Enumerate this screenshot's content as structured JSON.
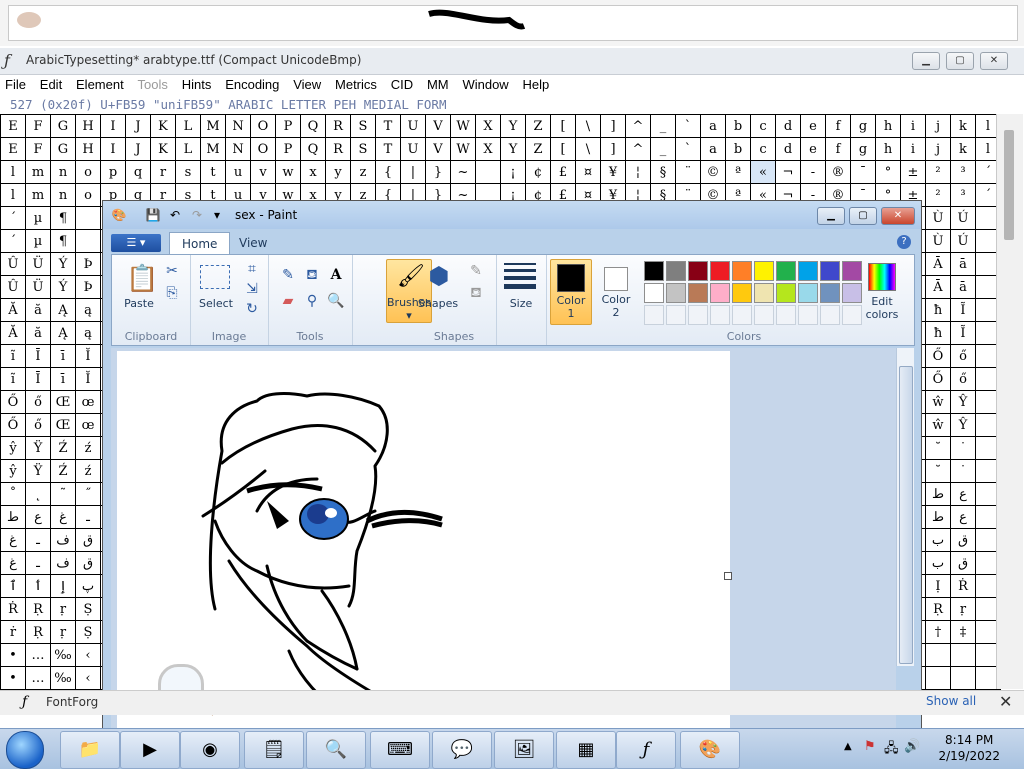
{
  "fontforge": {
    "title": "ArabicTypesetting*  arabtype.ttf (Compact UnicodeBmp)",
    "menu": [
      "File",
      "Edit",
      "Element",
      "Tools",
      "Hints",
      "Encoding",
      "View",
      "Metrics",
      "CID",
      "MM",
      "Window",
      "Help"
    ],
    "info_line": "527 (0x20f) U+FB59 \"uniFB59\" ARABIC LETTER PEH MEDIAL FORM",
    "grid_rows": [
      [
        "E",
        "F",
        "G",
        "H",
        "I",
        "J",
        "K",
        "L",
        "M",
        "N",
        "O",
        "P",
        "Q",
        "R",
        "S",
        "T",
        "U",
        "V",
        "W",
        "X",
        "Y",
        "Z",
        "[",
        "\\",
        "]",
        "^",
        "_",
        "`",
        "a",
        "b",
        "c",
        "d",
        "e",
        "f",
        "g",
        "h",
        "i",
        "j",
        "k",
        "l"
      ],
      [
        "E",
        "F",
        "G",
        "H",
        "I",
        "J",
        "K",
        "L",
        "M",
        "N",
        "O",
        "P",
        "Q",
        "R",
        "S",
        "T",
        "U",
        "V",
        "W",
        "X",
        "Y",
        "Z",
        "[",
        "\\",
        "]",
        "^",
        "_",
        "`",
        "a",
        "b",
        "c",
        "d",
        "e",
        "f",
        "g",
        "h",
        "i",
        "j",
        "k",
        "l"
      ],
      [
        "l",
        "m",
        "n",
        "o",
        "p",
        "q",
        "r",
        "s",
        "t",
        "u",
        "v",
        "w",
        "x",
        "y",
        "z",
        "{",
        "|",
        "}",
        "~",
        "",
        "¡",
        "¢",
        "£",
        "¤",
        "¥",
        "¦",
        "§",
        "¨",
        "©",
        "ª",
        "«",
        "¬",
        "-",
        "®",
        "¯",
        "°",
        "±",
        "²",
        "³",
        "´"
      ],
      [
        "l",
        "m",
        "n",
        "o",
        "p",
        "q",
        "r",
        "s",
        "t",
        "u",
        "v",
        "w",
        "x",
        "y",
        "z",
        "{",
        "|",
        "}",
        "~",
        "",
        "¡",
        "¢",
        "£",
        "¤",
        "¥",
        "¦",
        "§",
        "¨",
        "©",
        "ª",
        "«",
        "¬",
        "-",
        "®",
        "¯",
        "°",
        "±",
        "²",
        "³",
        "´"
      ],
      [
        "´",
        "µ",
        "¶",
        "",
        "",
        "",
        "",
        "",
        "",
        "",
        "",
        "",
        "",
        "",
        "",
        "",
        "",
        "",
        "",
        "",
        "",
        "",
        "",
        "",
        "",
        "",
        "",
        "",
        "",
        "",
        "",
        "",
        "",
        "",
        "",
        "",
        "",
        "Ù",
        "Ú",
        ""
      ],
      [
        "´",
        "µ",
        "¶",
        "",
        "",
        "",
        "",
        "",
        "",
        "",
        "",
        "",
        "",
        "",
        "",
        "",
        "",
        "",
        "",
        "",
        "",
        "",
        "",
        "",
        "",
        "",
        "",
        "",
        "",
        "",
        "",
        "",
        "",
        "",
        "",
        "",
        "",
        "Ù",
        "Ú",
        ""
      ],
      [
        "Û",
        "Ü",
        "Ý",
        "Þ",
        "",
        "",
        "",
        "",
        "",
        "",
        "",
        "",
        "",
        "",
        "",
        "",
        "",
        "",
        "",
        "",
        "",
        "",
        "",
        "",
        "",
        "",
        "",
        "",
        "",
        "",
        "",
        "",
        "",
        "",
        "",
        "",
        "",
        "Ā",
        "ā",
        ""
      ],
      [
        "Û",
        "Ü",
        "Ý",
        "Þ",
        "",
        "",
        "",
        "",
        "",
        "",
        "",
        "",
        "",
        "",
        "",
        "",
        "",
        "",
        "",
        "",
        "",
        "",
        "",
        "",
        "",
        "",
        "",
        "",
        "",
        "",
        "",
        "",
        "",
        "",
        "",
        "",
        "",
        "Ā",
        "ā",
        ""
      ],
      [
        "Ă",
        "ă",
        "Ą",
        "ą",
        "",
        "",
        "",
        "",
        "",
        "",
        "",
        "",
        "",
        "",
        "",
        "",
        "",
        "",
        "",
        "",
        "",
        "",
        "",
        "",
        "",
        "",
        "",
        "",
        "",
        "",
        "",
        "",
        "",
        "",
        "",
        "",
        "",
        "ħ",
        "Ĩ",
        ""
      ],
      [
        "Ă",
        "ă",
        "Ą",
        "ą",
        "",
        "",
        "",
        "",
        "",
        "",
        "",
        "",
        "",
        "",
        "",
        "",
        "",
        "",
        "",
        "",
        "",
        "",
        "",
        "",
        "",
        "",
        "",
        "",
        "",
        "",
        "",
        "",
        "",
        "",
        "",
        "",
        "",
        "ħ",
        "Ĩ",
        ""
      ],
      [
        "ĩ",
        "Ī",
        "ī",
        "Ĭ",
        "",
        "",
        "",
        "",
        "",
        "",
        "",
        "",
        "",
        "",
        "",
        "",
        "",
        "",
        "",
        "",
        "",
        "",
        "",
        "",
        "",
        "",
        "",
        "",
        "",
        "",
        "",
        "",
        "",
        "",
        "",
        "",
        "",
        "Ő",
        "ő",
        ""
      ],
      [
        "ĩ",
        "Ī",
        "ī",
        "Ĭ",
        "",
        "",
        "",
        "",
        "",
        "",
        "",
        "",
        "",
        "",
        "",
        "",
        "",
        "",
        "",
        "",
        "",
        "",
        "",
        "",
        "",
        "",
        "",
        "",
        "",
        "",
        "",
        "",
        "",
        "",
        "",
        "",
        "",
        "Ő",
        "ő",
        ""
      ],
      [
        "Ő",
        "ő",
        "Œ",
        "œ",
        "",
        "",
        "",
        "",
        "",
        "",
        "",
        "",
        "",
        "",
        "",
        "",
        "",
        "",
        "",
        "",
        "",
        "",
        "",
        "",
        "",
        "",
        "",
        "",
        "",
        "",
        "",
        "",
        "",
        "",
        "",
        "",
        "",
        "ŵ",
        "Ŷ",
        ""
      ],
      [
        "Ő",
        "ő",
        "Œ",
        "œ",
        "",
        "",
        "",
        "",
        "",
        "",
        "",
        "",
        "",
        "",
        "",
        "",
        "",
        "",
        "",
        "",
        "",
        "",
        "",
        "",
        "",
        "",
        "",
        "",
        "",
        "",
        "",
        "",
        "",
        "",
        "",
        "",
        "",
        "ŵ",
        "Ŷ",
        ""
      ],
      [
        "ŷ",
        "Ÿ",
        "Ź",
        "ź",
        "",
        "",
        "",
        "",
        "",
        "",
        "",
        "",
        "",
        "",
        "",
        "",
        "",
        "",
        "",
        "",
        "",
        "",
        "",
        "",
        "",
        "",
        "",
        "",
        "",
        "",
        "",
        "",
        "",
        "",
        "",
        "",
        "",
        "˘",
        "˙",
        ""
      ],
      [
        "ŷ",
        "Ÿ",
        "Ź",
        "ź",
        "",
        "",
        "",
        "",
        "",
        "",
        "",
        "",
        "",
        "",
        "",
        "",
        "",
        "",
        "",
        "",
        "",
        "",
        "",
        "",
        "",
        "",
        "",
        "",
        "",
        "",
        "",
        "",
        "",
        "",
        "",
        "",
        "",
        "˘",
        "˙",
        ""
      ],
      [
        "˚",
        "˛",
        "˜",
        "˝",
        "",
        "",
        "",
        "",
        "",
        "",
        "",
        "",
        "",
        "",
        "",
        "",
        "",
        "",
        "",
        "",
        "",
        "",
        "",
        "",
        "",
        "",
        "",
        "",
        "",
        "",
        "",
        "",
        "",
        "",
        "",
        "",
        "",
        "ط",
        "ع",
        ""
      ],
      [
        "ط",
        "ع",
        "غ",
        "ـ",
        "",
        "",
        "",
        "",
        "",
        "",
        "",
        "",
        "",
        "",
        "",
        "",
        "",
        "",
        "",
        "",
        "",
        "",
        "",
        "",
        "",
        "",
        "",
        "",
        "",
        "",
        "",
        "",
        "",
        "",
        "",
        "",
        "",
        "ط",
        "ع",
        ""
      ],
      [
        "غ",
        "ـ",
        "ف",
        "ق",
        "",
        "",
        "",
        "",
        "",
        "",
        "",
        "",
        "",
        "",
        "",
        "",
        "",
        "",
        "",
        "",
        "",
        "",
        "",
        "",
        "",
        "",
        "",
        "",
        "",
        "",
        "",
        "",
        "",
        "",
        "",
        "",
        "",
        "ب",
        "ق",
        ""
      ],
      [
        "غ",
        "ـ",
        "ف",
        "ق",
        "",
        "",
        "",
        "",
        "",
        "",
        "",
        "",
        "",
        "",
        "",
        "",
        "",
        "",
        "",
        "",
        "",
        "",
        "",
        "",
        "",
        "",
        "",
        "",
        "",
        "",
        "",
        "",
        "",
        "",
        "",
        "",
        "",
        "ب",
        "ق",
        ""
      ],
      [
        "ٱ",
        "ٲ",
        "ٳ",
        "پ",
        "",
        "",
        "",
        "",
        "",
        "",
        "",
        "",
        "",
        "",
        "",
        "",
        "",
        "",
        "",
        "",
        "",
        "",
        "",
        "",
        "",
        "",
        "",
        "",
        "",
        "",
        "",
        "",
        "",
        "",
        "",
        "",
        "",
        "Ị",
        "Ṙ",
        ""
      ],
      [
        "Ṙ",
        "Ṛ",
        "ṛ",
        "Ṣ",
        "",
        "",
        "",
        "",
        "",
        "",
        "",
        "",
        "",
        "",
        "",
        "",
        "",
        "",
        "",
        "",
        "",
        "",
        "",
        "",
        "",
        "",
        "",
        "",
        "",
        "",
        "",
        "",
        "",
        "",
        "",
        "",
        "",
        "Ṛ",
        "ṛ",
        ""
      ],
      [
        "ṙ",
        "Ṛ",
        "ṛ",
        "Ṣ",
        "",
        "",
        "",
        "",
        "",
        "",
        "",
        "",
        "",
        "",
        "",
        "",
        "",
        "",
        "",
        "",
        "",
        "",
        "",
        "",
        "",
        "",
        "",
        "",
        "",
        "",
        "",
        "",
        "",
        "",
        "",
        "",
        "",
        "†",
        "‡",
        ""
      ],
      [
        "•",
        "…",
        "‰",
        "‹",
        "",
        "",
        "",
        "",
        "",
        "",
        "",
        "",
        "",
        "",
        "",
        "",
        "",
        "",
        "",
        "",
        "",
        "",
        "",
        "",
        "",
        "",
        "",
        "",
        "",
        "",
        "",
        "",
        "",
        "",
        "",
        "",
        "",
        "",
        "",
        ""
      ],
      [
        "•",
        "…",
        "‰",
        "‹",
        "",
        "",
        "",
        "",
        "",
        "",
        "",
        "",
        "",
        "",
        "",
        "",
        "",
        "",
        "",
        "",
        "",
        "",
        "",
        "",
        "",
        "",
        "",
        "",
        "",
        "",
        "",
        "",
        "",
        "",
        "",
        "",
        "",
        "",
        "",
        ""
      ]
    ],
    "status_label": "FontForg",
    "show_all": "Show all"
  },
  "paint": {
    "title": "sex - Paint",
    "tabs": [
      "Home",
      "View"
    ],
    "groups": {
      "clipboard": "Clipboard",
      "image": "Image",
      "tools": "Tools",
      "shapes": "Shapes",
      "colors": "Colors"
    },
    "buttons": {
      "paste": "Paste",
      "select": "Select",
      "brushes": "Brushes",
      "shapes": "Shapes",
      "size": "Size",
      "color1": "Color\n1",
      "color2": "Color\n2",
      "edit_colors": "Edit\ncolors"
    },
    "palette": [
      "#000000",
      "#7f7f7f",
      "#880015",
      "#ed1c24",
      "#ff7f27",
      "#fff200",
      "#22b14c",
      "#00a2e8",
      "#3f48cc",
      "#a349a4",
      "#ffffff",
      "#c3c3c3",
      "#b97a57",
      "#ffaec9",
      "#ffc90e",
      "#efe4b0",
      "#b5e61d",
      "#99d9ea",
      "#7092be",
      "#c8bfe7"
    ],
    "color1": "#000000",
    "color2": "#ffffff"
  },
  "taskbar": {
    "time": "8:14 PM",
    "date": "2/19/2022"
  }
}
